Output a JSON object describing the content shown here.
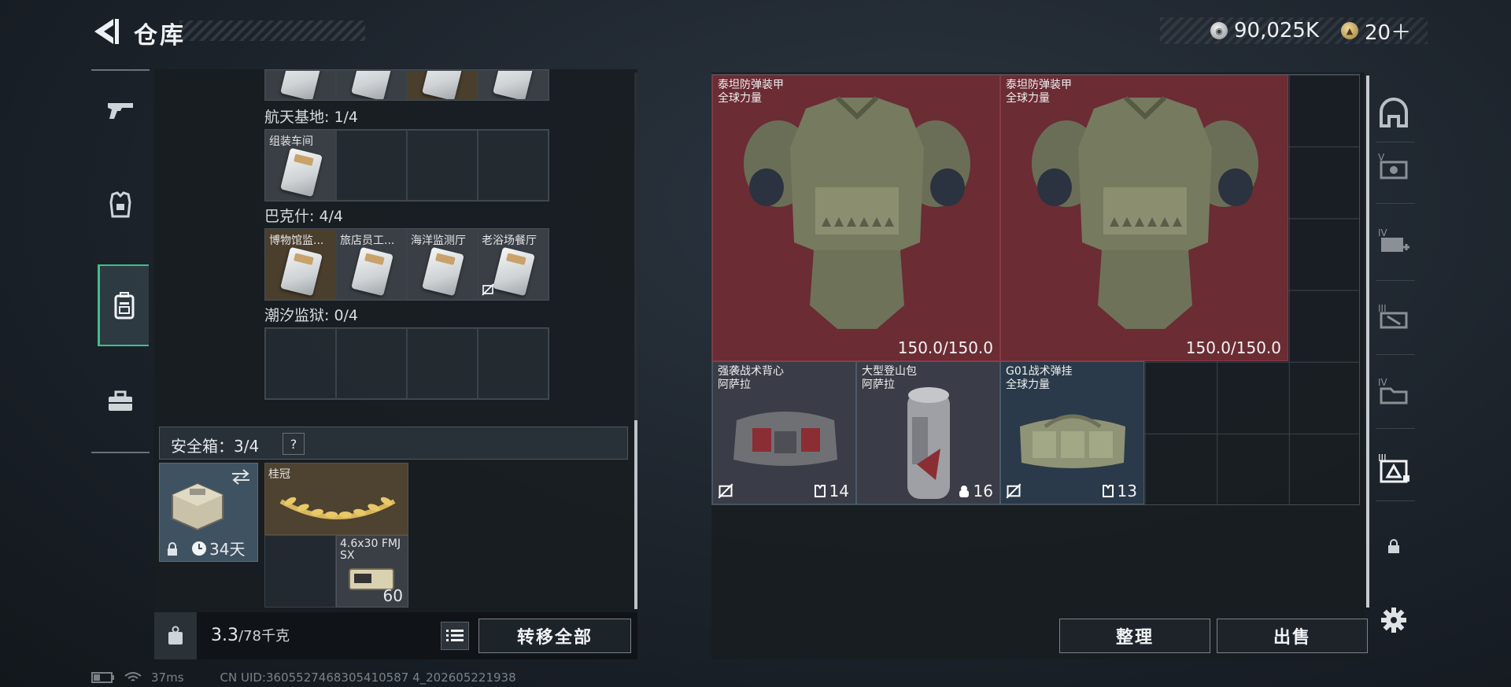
{
  "header": {
    "title": "仓库",
    "currencies": [
      {
        "icon": "silver-coin-icon",
        "value": "90,025K"
      },
      {
        "icon": "gold-coin-icon",
        "value": "20＋"
      }
    ]
  },
  "nav": {
    "items": [
      {
        "icon": "gun-icon",
        "active": false
      },
      {
        "icon": "armor-icon",
        "active": false
      },
      {
        "icon": "backpack-icon",
        "active": true
      },
      {
        "icon": "toolbox-icon",
        "active": false
      }
    ]
  },
  "keycards": {
    "sections": [
      {
        "label": "航天基地: 1/4",
        "slots": [
          "组装车间",
          "",
          "",
          ""
        ]
      },
      {
        "label": "巴克什: 4/4",
        "slots": [
          "博物馆监...",
          "旅店员工...",
          "海洋监测厅",
          "老浴场餐厅"
        ]
      },
      {
        "label": "潮汐监狱: 0/4",
        "slots": [
          "",
          "",
          "",
          ""
        ]
      }
    ]
  },
  "safebox": {
    "label": "安全箱：3/4",
    "help": "?",
    "box_days": "34天",
    "laurel_name": "桂冠",
    "ammo_name": "4.6x30 FMJ SX",
    "ammo_count": "60"
  },
  "weight": {
    "current": "3.3",
    "max": "/78千克"
  },
  "buttons": {
    "transfer_all": "转移全部",
    "organize": "整理",
    "sell": "出售"
  },
  "stash": {
    "armors": [
      {
        "name": "泰坦防弹装甲",
        "brand": "全球力量",
        "durability": "150.0/150.0"
      },
      {
        "name": "泰坦防弹装甲",
        "brand": "全球力量",
        "durability": "150.0/150.0"
      }
    ],
    "bags": [
      {
        "name": "强袭战术背心",
        "brand": "阿萨拉",
        "slots": "14"
      },
      {
        "name": "大型登山包",
        "brand": "阿萨拉",
        "slots": "16"
      },
      {
        "name": "G01战术弹挂",
        "brand": "全球力量",
        "slots": "13"
      }
    ]
  },
  "side_categories": [
    {
      "icon": "helmet-category-icon",
      "tier": ""
    },
    {
      "icon": "vest-category-icon",
      "tier": "V"
    },
    {
      "icon": "medkit-category-icon",
      "tier": "IV"
    },
    {
      "icon": "ammo-category-icon",
      "tier": "III"
    },
    {
      "icon": "folder-category-icon",
      "tier": "IV"
    },
    {
      "icon": "safebox-category-icon",
      "tier": "III"
    },
    {
      "icon": "lock-icon",
      "tier": ""
    },
    {
      "icon": "gear-icon",
      "tier": ""
    }
  ],
  "footer": {
    "ping": "37ms",
    "uid": "CN UID:3605527468305410587 4_202605221938"
  }
}
